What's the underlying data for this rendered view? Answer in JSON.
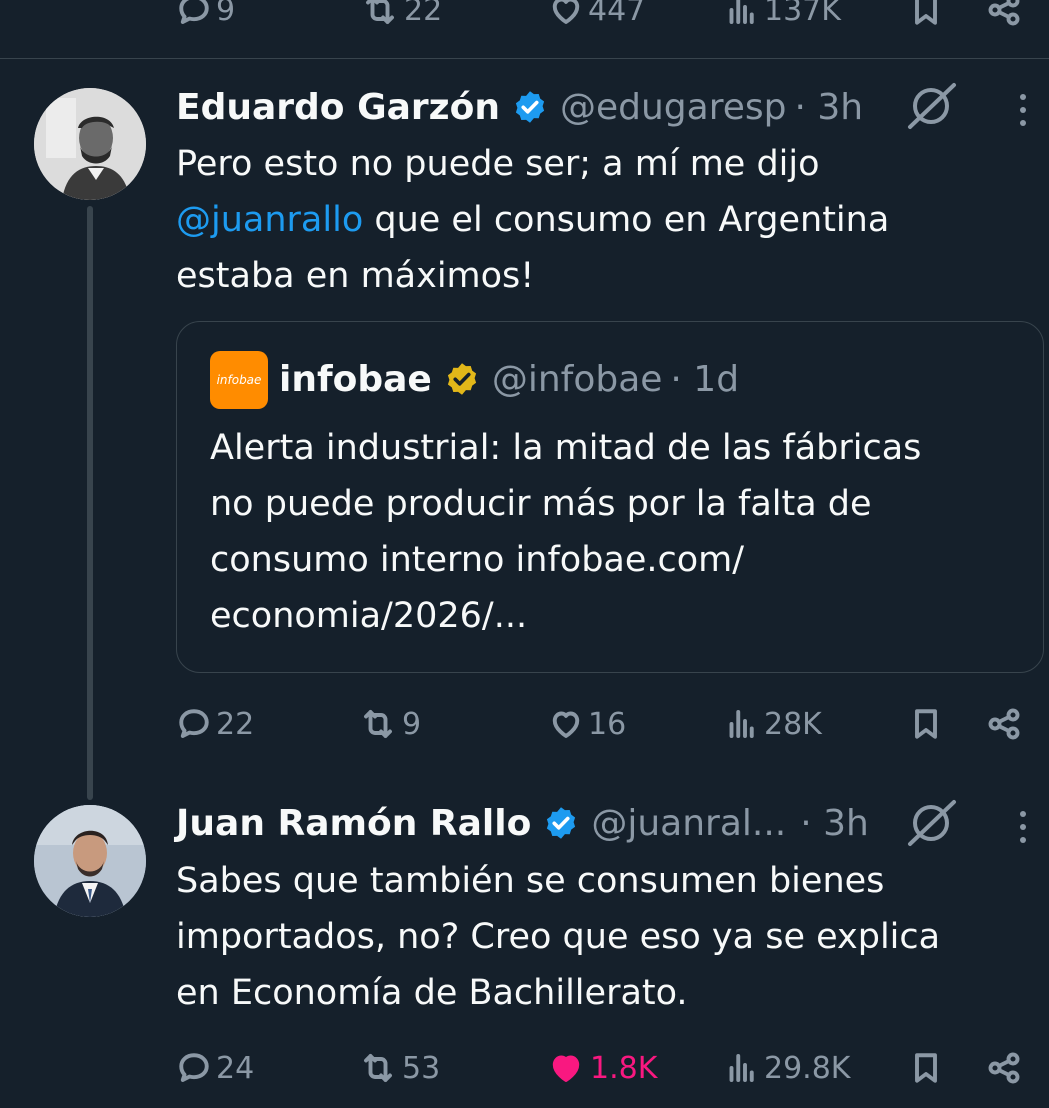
{
  "colors": {
    "background": "#15202b",
    "text_primary": "#f7f9f9",
    "text_secondary": "#8b98a5",
    "link": "#1d9bf0",
    "verified_blue": "#1d9bf0",
    "verified_gold": "#e2b719",
    "like_active": "#f91880",
    "divider": "#38444d"
  },
  "top_actions": {
    "replies": "9",
    "reposts": "22",
    "likes": "447",
    "views": "137K"
  },
  "tweet1": {
    "author_name": "Eduardo Garzón",
    "handle": "@edugaresp",
    "time": "· 3h",
    "text_before": "Pero esto no puede ser; a mí me dijo",
    "mention": "@juanrallo",
    "text_after_mention": " que el consumo en Argentina",
    "text_line3": "estaba en máximos!",
    "icons": [
      "verified-badge-icon",
      "grok-icon",
      "more-icon"
    ],
    "quote": {
      "logo_text": "infobae",
      "author_name": "infobae",
      "handle": "@infobae",
      "time": "· 1d",
      "lines": [
        "Alerta industrial: la mitad de las fábricas",
        "no puede producir más por la falta de",
        "consumo interno infobae.com/",
        "economia/2026/..."
      ]
    },
    "actions": {
      "replies": "22",
      "reposts": "9",
      "likes": "16",
      "views": "28K"
    }
  },
  "tweet2": {
    "author_name": "Juan Ramón Rallo",
    "handle": "@juanral...",
    "time": "· 3h",
    "lines": [
      "Sabes que también se consumen bienes",
      "importados, no? Creo que eso ya se explica",
      "en Economía de Bachillerato."
    ],
    "actions": {
      "replies": "24",
      "reposts": "53",
      "likes": "1.8K",
      "likes_active": true,
      "views": "29.8K"
    }
  }
}
